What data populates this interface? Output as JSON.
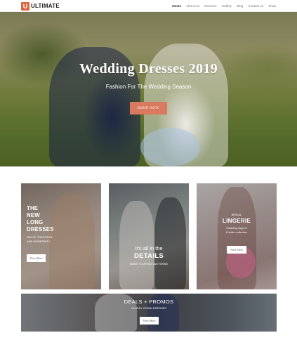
{
  "header": {
    "logo_mark": "U",
    "logo_text": "ULTIMATE",
    "nav": [
      "Home",
      "About Us",
      "Services",
      "Gallery",
      "Blog",
      "Contact us",
      "Shop"
    ]
  },
  "hero": {
    "title": "Wedding Dresses 2019",
    "subtitle": "Fashion For The Wedding Season",
    "button": "SHOP NOW"
  },
  "cards": {
    "new_long": {
      "title_lines": [
        "THE",
        "NEW",
        "LONG",
        "DRESSES"
      ],
      "sub_lines": [
        "MIX OF TRADITION",
        "AND MODERNITY"
      ],
      "button": "View More"
    },
    "details": {
      "line1": "It's all in the",
      "line2": "DETAILS",
      "sub": "MAKE YOUR BIG DAY SHINE"
    },
    "lingerie": {
      "eyebrow": "BRIDAL",
      "title": "LINGERIE",
      "sub_lines": [
        "Wedding lingerie",
        "& bride collection"
      ],
      "button": "View More"
    },
    "deals": {
      "title": "DEALS + PROMOS",
      "sub": "CLASSY GOWN DRESSES",
      "button": "View More"
    }
  },
  "colors": {
    "accent": "#d97a5e",
    "logo": "#d9633f"
  }
}
